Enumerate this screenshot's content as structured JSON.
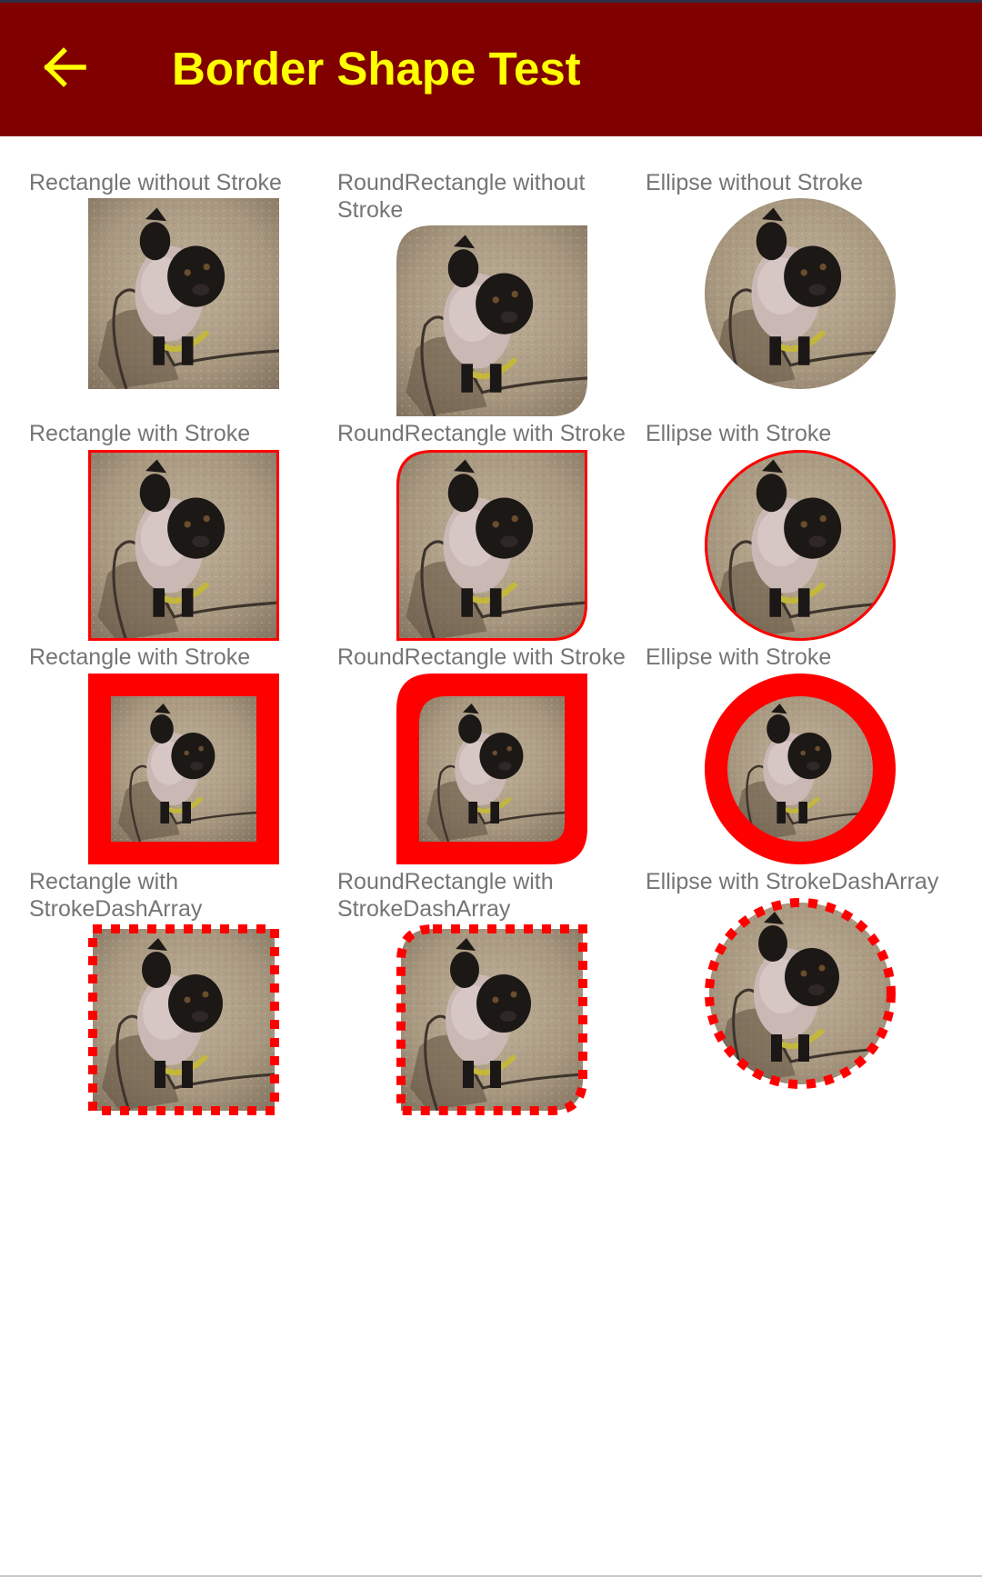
{
  "app_bar": {
    "title": "Border Shape Test",
    "back_icon": "arrow-left-icon",
    "background_color": "#800000",
    "title_color": "#ffff00"
  },
  "photo": {
    "description_icon": "pug-photo",
    "stroke_color": "#ff0000"
  },
  "cells": [
    {
      "label": "Rectangle without Stroke"
    },
    {
      "label": "RoundRectangle without Stroke"
    },
    {
      "label": "Ellipse without Stroke"
    },
    {
      "label": "Rectangle with Stroke"
    },
    {
      "label": "RoundRectangle with Stroke"
    },
    {
      "label": "Ellipse with Stroke"
    },
    {
      "label": "Rectangle with Stroke"
    },
    {
      "label": "RoundRectangle with Stroke"
    },
    {
      "label": "Ellipse with Stroke"
    },
    {
      "label": "Rectangle with StrokeDashArray"
    },
    {
      "label": "RoundRectangle with StrokeDashArray"
    },
    {
      "label": "Ellipse with StrokeDashArray"
    }
  ]
}
